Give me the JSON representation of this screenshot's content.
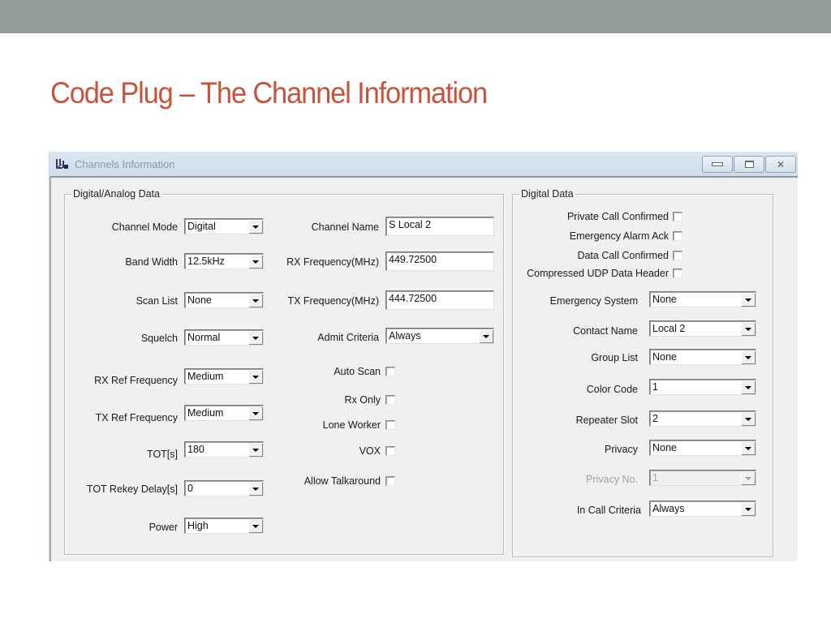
{
  "slide": {
    "title": "Code Plug – The Channel Information"
  },
  "window": {
    "title": "Channels Information",
    "icons": {
      "app": "channels-app-icon",
      "minimize": "minimize-icon",
      "maximize": "maximize-icon",
      "close": "close-icon"
    }
  },
  "digital_analog": {
    "legend": "Digital/Analog Data",
    "left_combos": [
      {
        "label": "Channel Mode",
        "value": "Digital"
      },
      {
        "label": "Band Width",
        "value": "12.5kHz"
      },
      {
        "label": "Scan List",
        "value": "None"
      },
      {
        "label": "Squelch",
        "value": "Normal"
      },
      {
        "label": "RX Ref Frequency",
        "value": "Medium"
      },
      {
        "label": "TX Ref Frequency",
        "value": "Medium"
      },
      {
        "label": "TOT[s]",
        "value": "180"
      },
      {
        "label": "TOT Rekey Delay[s]",
        "value": "0"
      },
      {
        "label": "Power",
        "value": "High"
      }
    ],
    "channel_name": {
      "label": "Channel Name",
      "value": "S  Local 2"
    },
    "rx_frequency": {
      "label": "RX Frequency(MHz)",
      "value": "449.72500"
    },
    "tx_frequency": {
      "label": "TX Frequency(MHz)",
      "value": "444.72500"
    },
    "admit_criteria": {
      "label": "Admit Criteria",
      "value": "Always"
    },
    "checkboxes": [
      {
        "label": "Auto Scan",
        "checked": false
      },
      {
        "label": "Rx Only",
        "checked": false
      },
      {
        "label": "Lone Worker",
        "checked": false
      },
      {
        "label": "VOX",
        "checked": false
      },
      {
        "label": "Allow Talkaround",
        "checked": false
      }
    ]
  },
  "digital_data": {
    "legend": "Digital Data",
    "checkboxes": [
      {
        "label": "Private Call Confirmed",
        "checked": false
      },
      {
        "label": "Emergency Alarm Ack",
        "checked": false
      },
      {
        "label": "Data Call Confirmed",
        "checked": false
      },
      {
        "label": "Compressed UDP Data Header",
        "checked": false
      }
    ],
    "combos": [
      {
        "label": "Emergency System",
        "value": "None",
        "disabled": false
      },
      {
        "label": "Contact Name",
        "value": "Local 2",
        "disabled": false
      },
      {
        "label": "Group List",
        "value": "None",
        "disabled": false
      },
      {
        "label": "Color Code",
        "value": "1",
        "disabled": false
      },
      {
        "label": "Repeater Slot",
        "value": "2",
        "disabled": false
      },
      {
        "label": "Privacy",
        "value": "None",
        "disabled": false
      },
      {
        "label": "Privacy No.",
        "value": "1",
        "disabled": true
      },
      {
        "label": "In Call Criteria",
        "value": "Always",
        "disabled": false
      }
    ]
  }
}
